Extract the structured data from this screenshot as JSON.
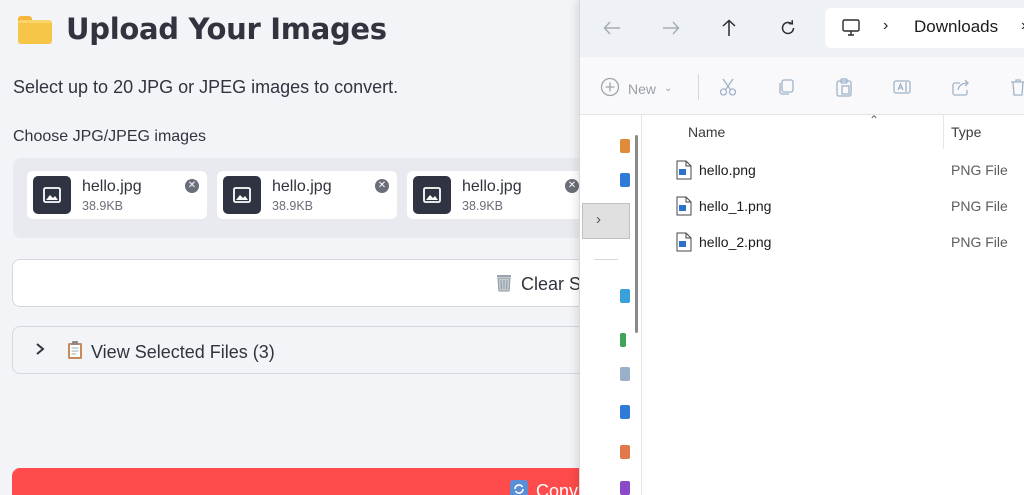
{
  "app": {
    "title": "Upload Your Images",
    "subtitle": "Select up to 20 JPG or JPEG images to convert.",
    "uploader_label": "Choose JPG/JPEG images",
    "files": [
      {
        "name": "hello.jpg",
        "size": "38.9KB"
      },
      {
        "name": "hello.jpg",
        "size": "38.9KB"
      },
      {
        "name": "hello.jpg",
        "size": "38.9KB"
      }
    ],
    "clear_label": "Clear Sel",
    "expander_label": "View Selected Files (3)",
    "convert_label": "Conv",
    "colors": {
      "primary": "#ff4b4b",
      "background": "#f3f4f8",
      "chip": "#ffffff"
    }
  },
  "explorer": {
    "breadcrumb": "Downloads",
    "toolbar": {
      "new_label": "New"
    },
    "columns": {
      "name": "Name",
      "type": "Type"
    },
    "files": [
      {
        "name": "hello.png",
        "type": "PNG File"
      },
      {
        "name": "hello_1.png",
        "type": "PNG File"
      },
      {
        "name": "hello_2.png",
        "type": "PNG File"
      }
    ]
  }
}
